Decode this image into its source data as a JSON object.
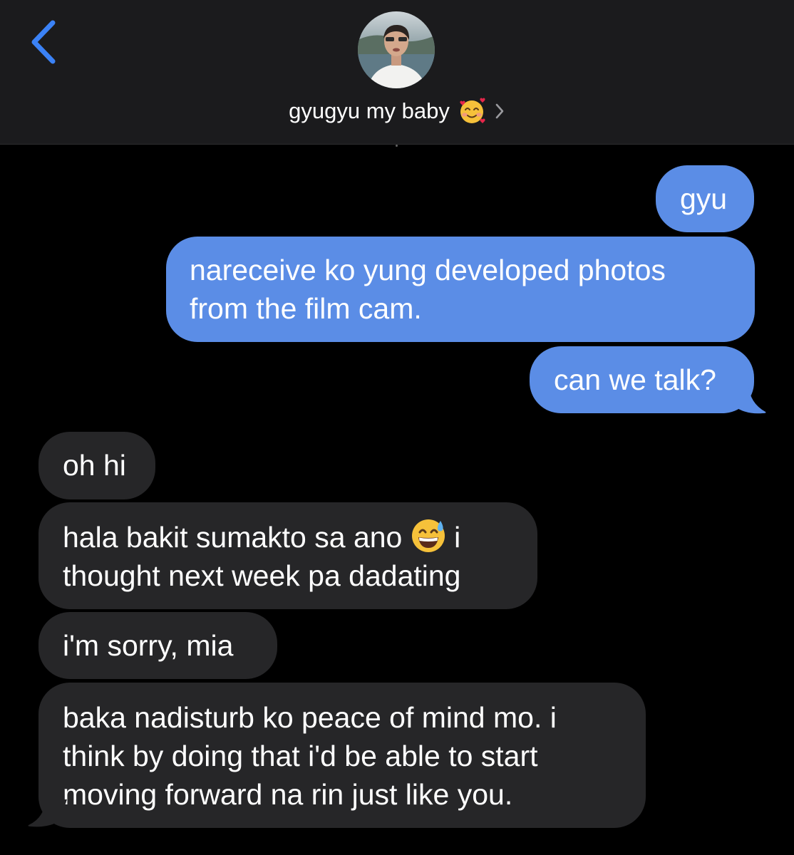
{
  "header": {
    "back_icon": "chevron-left-icon",
    "contact_name": "gyugyu my baby",
    "contact_emoji": "smiling-face-with-hearts",
    "chevron_icon": "chevron-right-icon"
  },
  "colors": {
    "sent_bubble": "#5b8de6",
    "received_bubble": "#262628",
    "accent": "#3b82f6",
    "header_bg": "#1b1b1d"
  },
  "messages": [
    {
      "from": "me",
      "text": "gyu"
    },
    {
      "from": "me",
      "lines": [
        "nareceive ko yung developed photos",
        "from the film cam."
      ]
    },
    {
      "from": "me",
      "text": "can we talk?"
    },
    {
      "from": "them",
      "text": "oh hi"
    },
    {
      "from": "them",
      "line1_before_emoji": "hala bakit sumakto sa ano",
      "emoji": "grinning-face-with-sweat",
      "line1_after_emoji": "i",
      "line2": "thought next week pa dadating"
    },
    {
      "from": "them",
      "text": "i'm sorry, mia"
    },
    {
      "from": "them",
      "lines": [
        "baka nadisturb ko peace of mind mo. i",
        "think by doing that i'd be able to start",
        "moving forward na rin just like you."
      ]
    }
  ]
}
